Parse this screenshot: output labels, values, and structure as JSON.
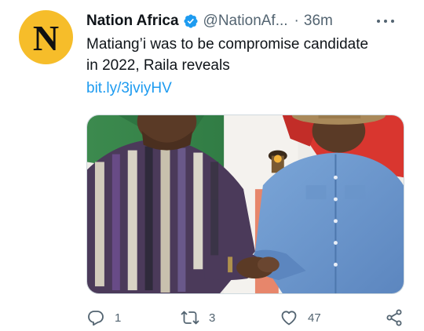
{
  "tweet": {
    "avatar_letter": "N",
    "display_name": "Nation Africa",
    "handle": "@NationAf...",
    "separator": "·",
    "time": "36m",
    "text_lines": [
      "Matiang’i was to be compromise candidate",
      "in 2022, Raila reveals"
    ],
    "link": "bit.ly/3jviyHV",
    "actions": {
      "reply_count": "1",
      "retweet_count": "3",
      "like_count": "47"
    }
  },
  "colors": {
    "avatar_bg": "#f6bd2a",
    "verified": "#1d9bf0",
    "link": "#1d9bf0",
    "muted": "#536471",
    "text": "#0f1419"
  },
  "icons": [
    "verified-badge-icon",
    "more-icon",
    "reply-icon",
    "retweet-icon",
    "like-icon",
    "share-icon"
  ]
}
